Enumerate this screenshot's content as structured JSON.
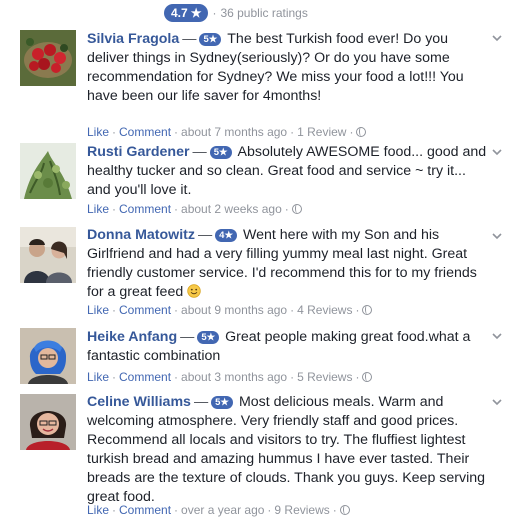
{
  "summary": {
    "rating": "4.7",
    "star": "★",
    "separator": "·",
    "text": "36 public ratings"
  },
  "action_labels": {
    "like": "Like",
    "comment": "Comment",
    "dot": "·"
  },
  "reviews": [
    {
      "name": "Silvia Fragola",
      "dash": "—",
      "badge": "5★",
      "text": "The best Turkish food ever! Do you deliver things in Sydney(seriously)? Or do you have some recommendation for Sydney? We miss your food a lot!!! You have been our life saver for 4months!",
      "time": "about 7 months ago",
      "review_count": "1 Review",
      "avatar_icon": "red-berries-photo"
    },
    {
      "name": "Rusti Gardener",
      "dash": "—",
      "badge": "5★",
      "text": "Absolutely AWESOME food... good and healthy tucker and so clean. Great food and service ~ try it... and you'll love it.",
      "time": "about 2 weeks ago",
      "review_count": "",
      "avatar_icon": "green-plant-photo"
    },
    {
      "name": "Donna Matowitz",
      "dash": "—",
      "badge": "4★",
      "text": "Went here with my Son and his Girlfriend and had a very filling yummy meal last night. Great friendly customer service. I'd recommend this for to my friends for a great feed",
      "emoji": "smiley-icon",
      "time": "about 9 months ago",
      "review_count": "4 Reviews",
      "avatar_icon": "two-people-photo"
    },
    {
      "name": "Heike Anfang",
      "dash": "—",
      "badge": "5★",
      "text": "Great people making great food.what a fantastic combination",
      "time": "about 3 months ago",
      "review_count": "5 Reviews",
      "avatar_icon": "blue-hair-woman-photo"
    },
    {
      "name": "Celine Williams",
      "dash": "—",
      "badge": "5★",
      "text": "Most delicious meals. Warm and welcoming atmosphere. Very friendly staff and good prices. Recommend all locals and visitors to try. The fluffiest lightest turkish bread and amazing hummus I have ever tasted. Their breads are the texture of clouds. Thank you guys. Keep serving great food.",
      "time": "over a year ago",
      "review_count": "9 Reviews",
      "avatar_icon": "smiling-woman-photo"
    }
  ]
}
